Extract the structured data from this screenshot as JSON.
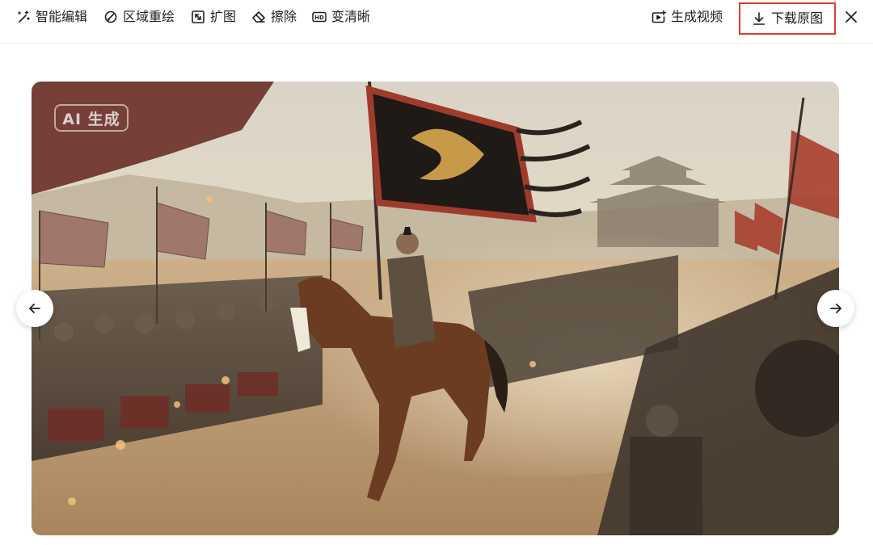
{
  "toolbar": {
    "smart_edit": {
      "label": "智能编辑",
      "icon": "magic-wand-icon"
    },
    "region_redraw": {
      "label": "区域重绘",
      "icon": "brush-icon"
    },
    "expand": {
      "label": "扩图",
      "icon": "expand-icon"
    },
    "erase": {
      "label": "擦除",
      "icon": "eraser-icon"
    },
    "enhance": {
      "label": "变清晰",
      "icon": "hd-icon"
    },
    "generate_video": {
      "label": "生成视频",
      "icon": "video-plus-icon"
    },
    "download": {
      "label": "下载原图",
      "icon": "download-icon"
    },
    "close": {
      "icon": "close-icon"
    }
  },
  "image": {
    "badge": "AI 生成"
  },
  "navigation": {
    "prev_icon": "arrow-left-icon",
    "next_icon": "arrow-right-icon"
  },
  "colors": {
    "highlight_border": "#d9412c",
    "toolbar_text": "#1f1f1f"
  }
}
